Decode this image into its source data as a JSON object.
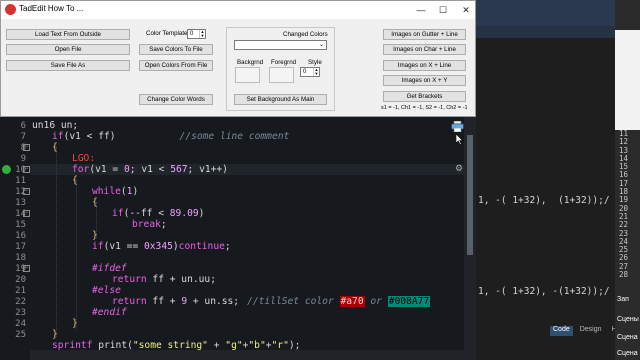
{
  "dialog": {
    "title": "TadEdit How To ...",
    "buttons": {
      "load_text": "Load Text From Outside",
      "open_file": "Open File",
      "save_file_as": "Save File As",
      "save_colors": "Save Colors To File",
      "open_colors": "Open Colors From File",
      "change_color_words": "Change Color Words",
      "set_background": "Set  Background  As Main",
      "images_gutter": "Images on Gutter + Line",
      "images_char": "Images on Char + Line",
      "images_x": "Images on X + Line",
      "images_xy": "Images on X + Y",
      "get_brackets": "Get  Brackets"
    },
    "color_template_label": "Color Template:",
    "color_template_value": "0",
    "changed_colors_label": "Changed Colors",
    "changed_colors_value": "",
    "backgrnd_label": "Backgrnd",
    "foregrnd_label": "Foregrnd",
    "style_label": "Style",
    "style_value": "0",
    "bracket_status": "s1 = -1, Ch1 = -1, S2 = -1, Ch2 = -1"
  },
  "editor": {
    "line_numbers": [
      "6",
      "7",
      "8",
      "9",
      "10",
      "11",
      "12",
      "13",
      "14",
      "15",
      "16",
      "17",
      "18",
      "19",
      "20",
      "21",
      "22",
      "23",
      "24",
      "25"
    ],
    "lines": {
      "l6": "un16 un;",
      "l7_kw": "if",
      "l7_a": "(v1 < ff)",
      "l7_cm": "//some line comment",
      "l8": "{",
      "l9": "LGO:",
      "l10_kw": "for",
      "l10_a": "(v1 = ",
      "l10_n1": "0",
      "l10_b": "; v1 < ",
      "l10_n2": "567",
      "l10_c": "; v1++)",
      "l11": "{",
      "l12_kw": "while",
      "l12_a": "(",
      "l12_n": "1",
      "l12_b": ")",
      "l13": "{",
      "l14_kw": "if",
      "l14_a": "(--ff < ",
      "l14_n": "89.09",
      "l14_b": ")",
      "l15_kw": "break",
      "l15_a": ";",
      "l16": "}",
      "l17_kw": "if",
      "l17_a": "(v1 == ",
      "l17_n": "0x345",
      "l17_b": ")",
      "l17_kw2": "continue",
      "l17_c": ";",
      "l19": "#ifdef",
      "l20_kw": "return",
      "l20_a": " ff + un.uu;",
      "l21": "#else",
      "l22_kw": "return",
      "l22_a": " ff + ",
      "l22_n": "9",
      "l22_b": " + un.ss;",
      "l22_cm": "//tillSet color ",
      "l22_c1": "#a70",
      "l22_or": " or ",
      "l22_c2": "#008A77",
      "l23": "#endif",
      "l24": "}",
      "l25": "}",
      "l26_kw": "sprintf",
      "l26_a": " print(",
      "l26_s1": "\"some string\"",
      "l26_b": " + ",
      "l26_s2": "\"g\"",
      "l26_c": "+",
      "l26_s3": "\"b\"",
      "l26_d": "+",
      "l26_s4": "\"r\"",
      "l26_e": ");"
    }
  },
  "background_window": {
    "line_a": "1, -( 1+32),  (1+32));/",
    "line_b": "1, -( 1+32), -(1+32));/",
    "tabs": [
      "Code",
      "Design",
      "H"
    ],
    "right_numbers": [
      "11",
      "12",
      "13",
      "14",
      "15",
      "16",
      "17",
      "18",
      "19",
      "20",
      "21",
      "22",
      "23",
      "24",
      "25",
      "26",
      "27",
      "28"
    ],
    "right_label_1": "Зап",
    "right_label_2": "Сцены",
    "right_label_3": "Сцена",
    "right_label_4": "Сцена"
  },
  "colors": {
    "accent_tag1": "#a70000",
    "accent_tag2": "#008a77",
    "keyword": "#ec5fe6",
    "string": "#f0f07a",
    "label": "#ff4040"
  }
}
